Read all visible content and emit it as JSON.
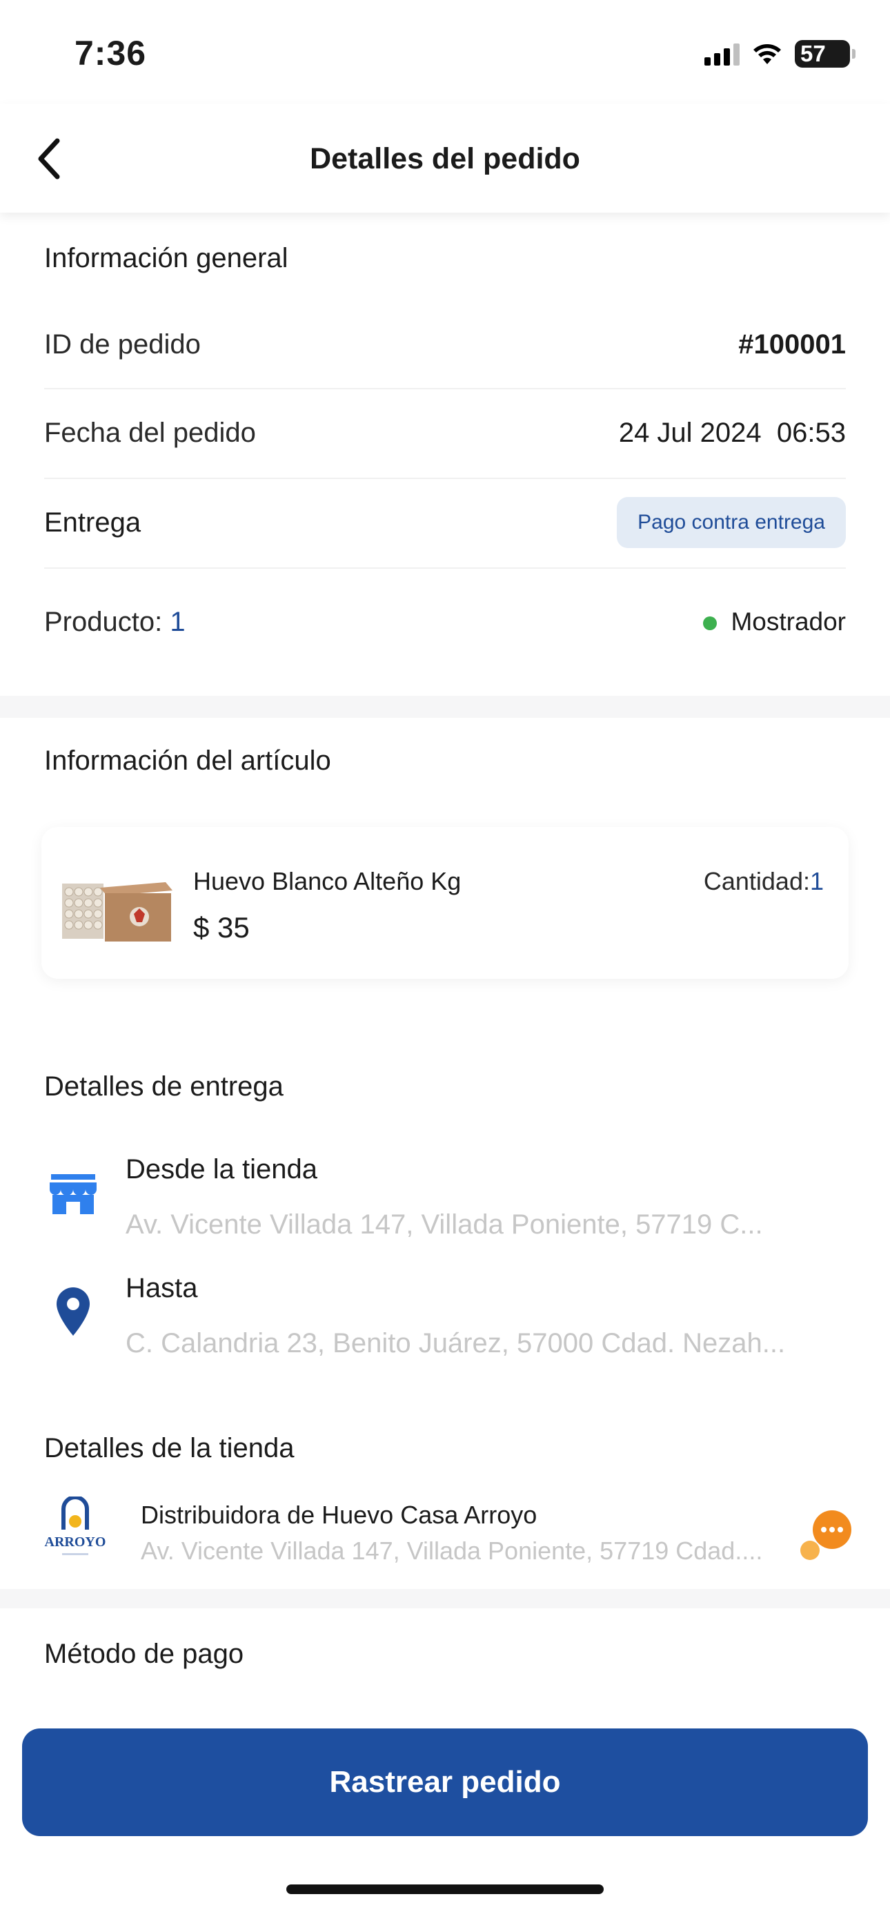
{
  "status_bar": {
    "time": "7:36",
    "battery": "57"
  },
  "header": {
    "title": "Detalles del pedido"
  },
  "general": {
    "title": "Información general",
    "order_id_label": "ID de pedido",
    "order_id_value": "#100001",
    "date_label": "Fecha del pedido",
    "date_value": "24 Jul 2024  06:53",
    "delivery_label": "Entrega",
    "delivery_badge": "Pago contra entrega",
    "product_label": "Producto:",
    "product_count": "1",
    "channel": "Mostrador"
  },
  "article": {
    "title": "Información del artículo",
    "name": "Huevo Blanco Alteño Kg",
    "price": "$ 35",
    "qty_label": "Cantidad:",
    "qty_value": "1"
  },
  "delivery": {
    "title": "Detalles de entrega",
    "from_label": "Desde la tienda",
    "from_address": "Av. Vicente Villada 147, Villada Poniente, 57719 C...",
    "to_label": "Hasta",
    "to_address": "C. Calandria 23, Benito Juárez, 57000 Cdad. Nezah..."
  },
  "store": {
    "title": "Detalles de la tienda",
    "name": "Distribuidora de Huevo Casa Arroyo",
    "address": "Av. Vicente Villada 147, Villada Poniente, 57719 Cdad....",
    "logo_text": "ARROYO"
  },
  "payment": {
    "title": "Método de pago",
    "track_button": "Rastrear pedido"
  },
  "icons": {
    "back": "chevron-left-icon",
    "store": "storefront-icon",
    "location": "location-pin-icon",
    "chat": "chat-bubble-icon"
  },
  "colors": {
    "primary": "#1e4fa0",
    "badge_bg": "#e3ebf5",
    "online_dot": "#3db04f",
    "chat_orange": "#f28b1e"
  }
}
